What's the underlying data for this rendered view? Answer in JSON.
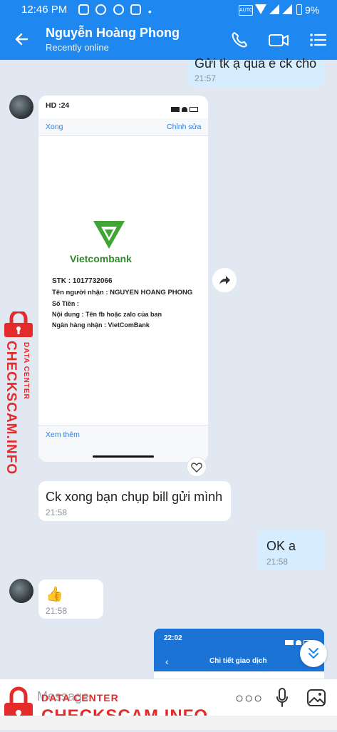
{
  "status_bar": {
    "time": "12:46 PM",
    "battery": "9%"
  },
  "header": {
    "contact_name": "Nguyễn Hoàng Phong",
    "status": "Recently online"
  },
  "messages": {
    "m1": {
      "text": "Gửi tk ạ qua e ck cho",
      "time": "21:57"
    },
    "receipt": {
      "status_time": "HD :24",
      "done": "Xong",
      "edit": "Chỉnh sửa",
      "bank_name": "Vietcombank",
      "stk": "STK :  1017732066",
      "recipient": "Tên người nhận :  NGUYEN HOANG PHONG",
      "amount": "Số Tiền :",
      "content": "Nội dung :  Tên fb hoặc zalo của ban",
      "bank": "Ngân hàng nhận :  VietComBank",
      "see_more": "Xem thêm"
    },
    "m2": {
      "text": "Ck xong bạn chụp bill gửi mình",
      "time": "21:58"
    },
    "m3": {
      "text": "OK a",
      "time": "21:58"
    },
    "m4": {
      "emoji": "👍",
      "time": "21:58"
    },
    "preview": {
      "time": "22:02",
      "title": "Chi tiết giao dịch"
    }
  },
  "input": {
    "placeholder": "Message"
  },
  "watermark": {
    "label": "DATA CENTER",
    "site": "CHECKSCAM.INFO"
  }
}
